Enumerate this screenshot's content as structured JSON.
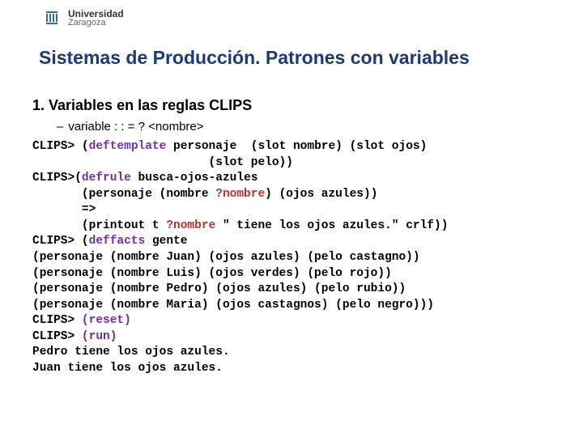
{
  "logo": {
    "line1": "Universidad",
    "line2": "Zaragoza"
  },
  "title": "Sistemas de Producción. Patrones con variables",
  "section": "1. Variables en las reglas CLIPS",
  "bullet": "variable : : = ? <nombre>",
  "code": {
    "l01a": "CLIPS> (",
    "l01b": "deftemplate",
    "l01c": " personaje  (slot nombre) (slot ojos)",
    "l02": "                         (slot pelo))",
    "l03a": "CLIPS>(",
    "l03b": "defrule",
    "l03c": " busca-ojos-azules",
    "l04a": "       (personaje (nombre ",
    "l04b": "?nombre",
    "l04c": ") (ojos azules))",
    "l05": "       =>",
    "l06a": "       (printout t ",
    "l06b": "?nombre",
    "l06c": " \" tiene los ojos azules.\" crlf))",
    "l07a": "CLIPS> (",
    "l07b": "deffacts",
    "l07c": " gente",
    "l08": "(personaje (nombre Juan) (ojos azules) (pelo castagno))",
    "l09": "(personaje (nombre Luis) (ojos verdes) (pelo rojo))",
    "l10": "(personaje (nombre Pedro) (ojos azules) (pelo rubio))",
    "l11": "(personaje (nombre Maria) (ojos castagnos) (pelo negro)))",
    "l12a": "CLIPS> ",
    "l12b": "(reset)",
    "l13a": "CLIPS> ",
    "l13b": "(run)",
    "l14": "Pedro tiene los ojos azules.",
    "l15": "Juan tiene los ojos azules."
  }
}
